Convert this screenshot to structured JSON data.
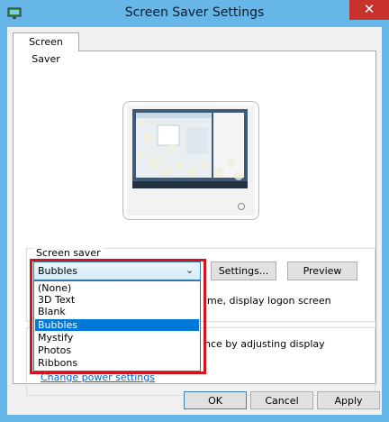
{
  "window": {
    "title": "Screen Saver Settings",
    "close_glyph": "✕",
    "app_icon": "screen-saver-app-icon"
  },
  "tab": {
    "label": "Screen Saver"
  },
  "screen_saver": {
    "group_label": "Screen saver",
    "selected": "Bubbles",
    "options": [
      "(None)",
      "3D Text",
      "Blank",
      "Bubbles",
      "Mystify",
      "Photos",
      "Ribbons"
    ],
    "selected_index": 3,
    "settings_label": "Settings...",
    "preview_label": "Preview",
    "logon_text_visible": "me, display logon screen"
  },
  "power": {
    "text_visible": "nce by adjusting display",
    "link_label": "Change power settings"
  },
  "buttons": {
    "ok": "OK",
    "cancel": "Cancel",
    "apply": "Apply"
  },
  "colors": {
    "accent": "#0078d7",
    "highlight_box": "#d2141e",
    "title_bar": "#67b6e8",
    "close": "#c7332a"
  }
}
